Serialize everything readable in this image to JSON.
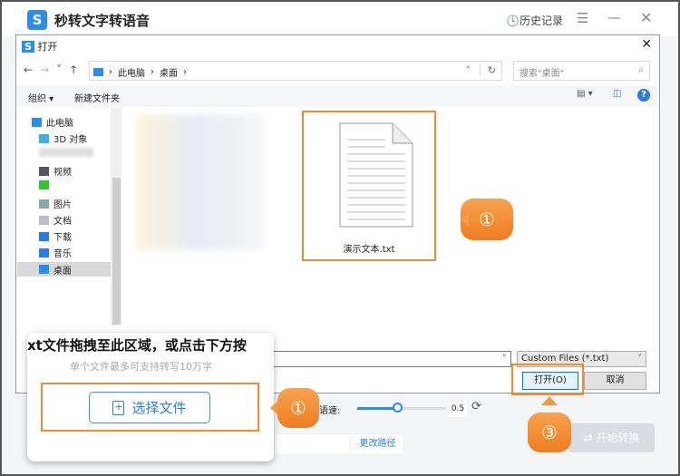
{
  "app": {
    "title": "秒转文字转语音",
    "logo_letter": "S",
    "history": "历史记录",
    "menu_icon": "☰",
    "min_icon": "—",
    "close_icon": "✕"
  },
  "dialog": {
    "title": "打开",
    "close": "✕",
    "nav": {
      "back": "←",
      "forward": "→",
      "recent": "˅",
      "up": "↑"
    },
    "breadcrumb": [
      "此电脑",
      "桌面"
    ],
    "search_placeholder": "搜索\"桌面\"",
    "organize": "组织 ▾",
    "new_folder": "新建文件夹",
    "sidebar": [
      {
        "label": "此电脑",
        "icon": "computer-icon",
        "color": "#2a8cf0"
      },
      {
        "label": "3D 对象",
        "icon": "cube-icon",
        "color": "#3cb0e0"
      },
      {
        "label": "",
        "icon": "blurred",
        "color": "#ddd"
      },
      {
        "label": "视频",
        "icon": "video-icon",
        "color": "#556"
      },
      {
        "label": "",
        "icon": "app-icon",
        "color": "#2ec52e"
      },
      {
        "label": "图片",
        "icon": "picture-icon",
        "color": "#8aa"
      },
      {
        "label": "文档",
        "icon": "document-icon",
        "color": "#bbc"
      },
      {
        "label": "下载",
        "icon": "download-icon",
        "color": "#2a7de1"
      },
      {
        "label": "音乐",
        "icon": "music-icon",
        "color": "#2a7de1"
      },
      {
        "label": "桌面",
        "icon": "desktop-icon",
        "color": "#2a8cf0",
        "selected": true
      }
    ],
    "file": {
      "name": "演示文本.txt"
    },
    "file_type": "Custom Files (*.txt)",
    "open": "打开(O)",
    "cancel": "取消"
  },
  "card": {
    "drop_text": "xt文件拖拽至此区域，或点击下方按",
    "limit": "单个文件最多可支持转写10万字",
    "choose": "选择文件"
  },
  "settings": {
    "speed_label": "语速:",
    "speed_value": "0.5",
    "speed_fraction": 0.45,
    "change_path": "更改路径",
    "start": "开始转换"
  },
  "callouts": [
    "①",
    "①",
    "③"
  ],
  "colors": {
    "accent": "#2a8cf0",
    "highlight": "#f08c2e"
  }
}
